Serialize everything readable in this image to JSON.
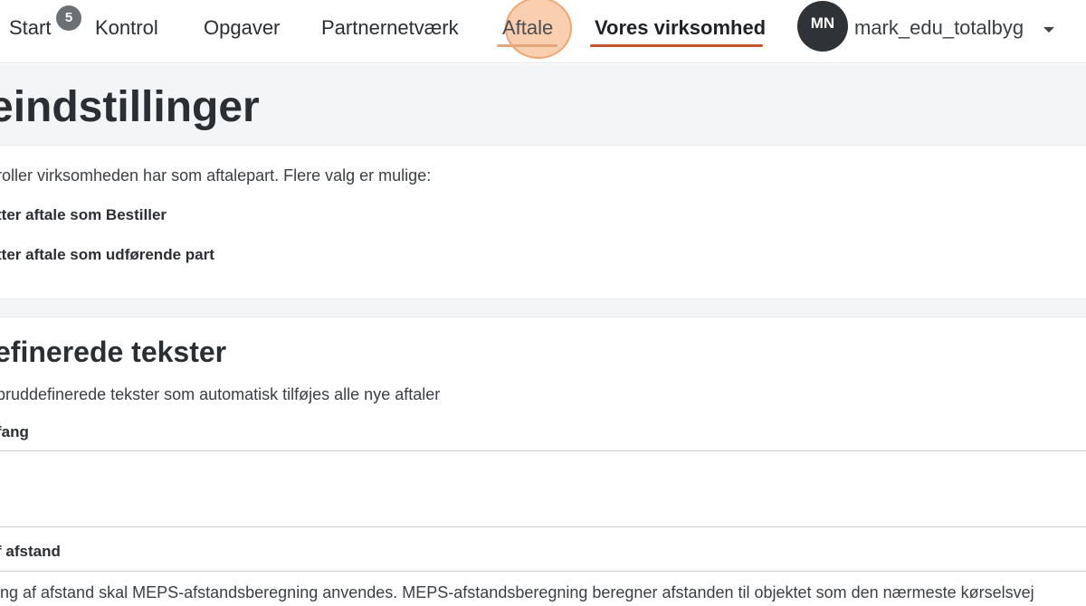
{
  "nav": {
    "start": "Start",
    "start_badge": "5",
    "kontrol": "Kontrol",
    "opgaver": "Opgaver",
    "partnernetvaerk": "Partnernetværk",
    "aftale": "Aftale",
    "vores_virksomhed": "Vores virksomhed",
    "avatar_initials": "MN",
    "username": "mark_edu_totalbyg",
    "user_menu_icon": "caret-down-icon"
  },
  "header": {
    "title": "eindstillinger"
  },
  "roles": {
    "description": "roller virksomheden har som aftalepart. Flere valg er mulige:",
    "option_1": "tter aftale som Bestiller",
    "option_2": "tter aftale som udførende part"
  },
  "predefined": {
    "title": "efinerede tekster",
    "description": "pruddefinerede tekster som automatisk tilføjes alle nye aftaler",
    "field_1_label": "fang",
    "field_1_value": "",
    "field_2_label": "f afstand",
    "field_2_description": "ing af afstand skal MEPS-afstandsberegning anvendes. MEPS-afstandsberegning beregner afstanden til objektet som den nærmeste kørselsvej"
  },
  "colors": {
    "active_underline": "#c8552a",
    "hover_underline": "#e3a77d",
    "avatar_bg": "#2e3338",
    "badge_bg": "#6b7074",
    "band_bg": "#f4f5f6"
  }
}
